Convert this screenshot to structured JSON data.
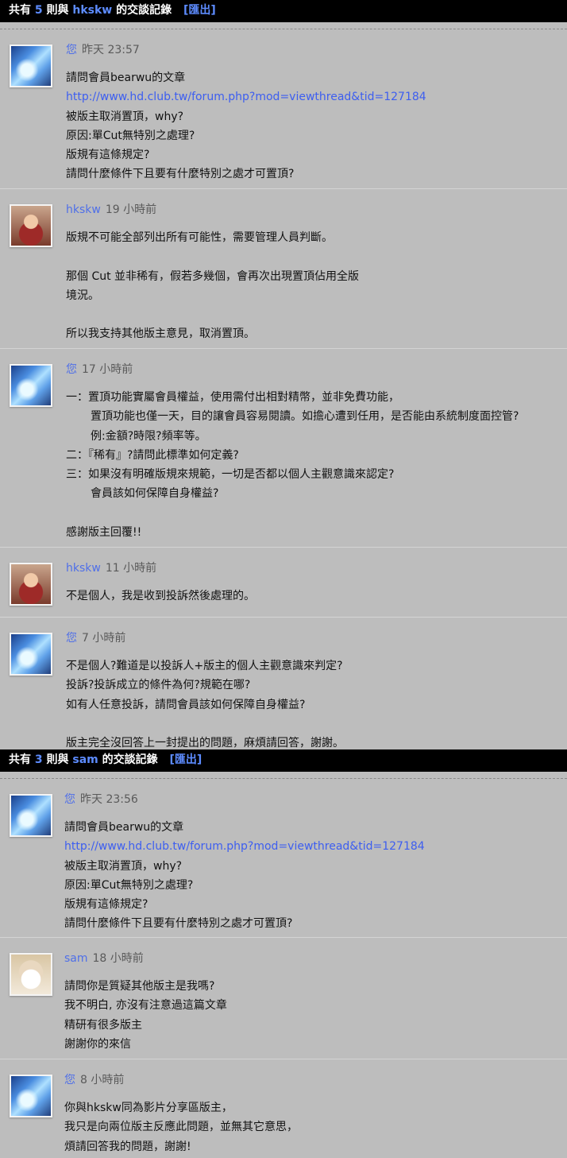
{
  "sections": [
    {
      "prefix": "共有",
      "count": "5",
      "mid": "則與",
      "user": "hkskw",
      "suffix": "的交談記錄",
      "export": "[匯出]",
      "messages": [
        {
          "name": "您",
          "time": "昨天 23:57",
          "lines": [
            "請問會員bearwu的文章",
            "http://www.hd.club.tw/forum.php?mod=viewthread&tid=127184",
            "被版主取消置頂，why?",
            "原因:單Cut無特別之處理?",
            "版規有這條規定?",
            "請問什麼條件下且要有什麼特別之處才可置頂?"
          ]
        },
        {
          "name": "hkskw",
          "time": "19 小時前",
          "lines": [
            "版規不可能全部列出所有可能性，需要管理人員判斷。",
            "",
            "那個 Cut 並非稀有，假若多幾個，會再次出現置頂佔用全版",
            "境況。",
            "",
            "所以我支持其他版主意見，取消置頂。"
          ]
        },
        {
          "name": "您",
          "time": "17 小時前",
          "lines": [
            "一：置頂功能實屬會員權益，使用需付出相對精幣，並非免費功能，",
            "置頂功能也僅一天，目的讓會員容易閱讀。如擔心遭到任用，是否能由系統制度面控管?",
            "例:金額?時限?頻率等。",
            "二：『稀有』?請問此標準如何定義?",
            "三：如果沒有明確版規來規範，一切是否都以個人主觀意識來認定?",
            "會員該如何保障自身權益?",
            "",
            "感謝版主回覆!!"
          ]
        },
        {
          "name": "hkskw",
          "time": "11 小時前",
          "lines": [
            "不是個人，我是收到投訴然後處理的。"
          ]
        },
        {
          "name": "您",
          "time": "7 小時前",
          "lines": [
            "不是個人?難道是以投訴人+版主的個人主觀意識來判定?",
            "投訴?投訴成立的條件為何?規範在哪?",
            "如有人任意投訴，請問會員該如何保障自身權益?",
            "",
            "版主完全沒回答上一封提出的問題，麻煩請回答，謝謝。"
          ]
        }
      ]
    },
    {
      "prefix": "共有",
      "count": "3",
      "mid": "則與",
      "user": "sam",
      "suffix": "的交談記錄",
      "export": "[匯出]",
      "messages": [
        {
          "name": "您",
          "time": "昨天 23:56",
          "lines": [
            "請問會員bearwu的文章",
            "http://www.hd.club.tw/forum.php?mod=viewthread&tid=127184",
            "被版主取消置頂，why?",
            "原因:單Cut無特別之處理?",
            "版規有這條規定?",
            "請問什麼條件下且要有什麼特別之處才可置頂?"
          ]
        },
        {
          "name": "sam",
          "time": "18 小時前",
          "lines": [
            "請問你是質疑其他版主是我嗎?",
            "我不明白, 亦沒有注意過這篇文章",
            "精研有很多版主",
            "謝謝你的來信"
          ]
        },
        {
          "name": "您",
          "time": "8 小時前",
          "lines": [
            "你與hkskw同為影片分享區版主，",
            "我只是向兩位版主反應此問題，並無其它意思，",
            "煩請回答我的問題，謝謝!"
          ]
        }
      ]
    }
  ]
}
